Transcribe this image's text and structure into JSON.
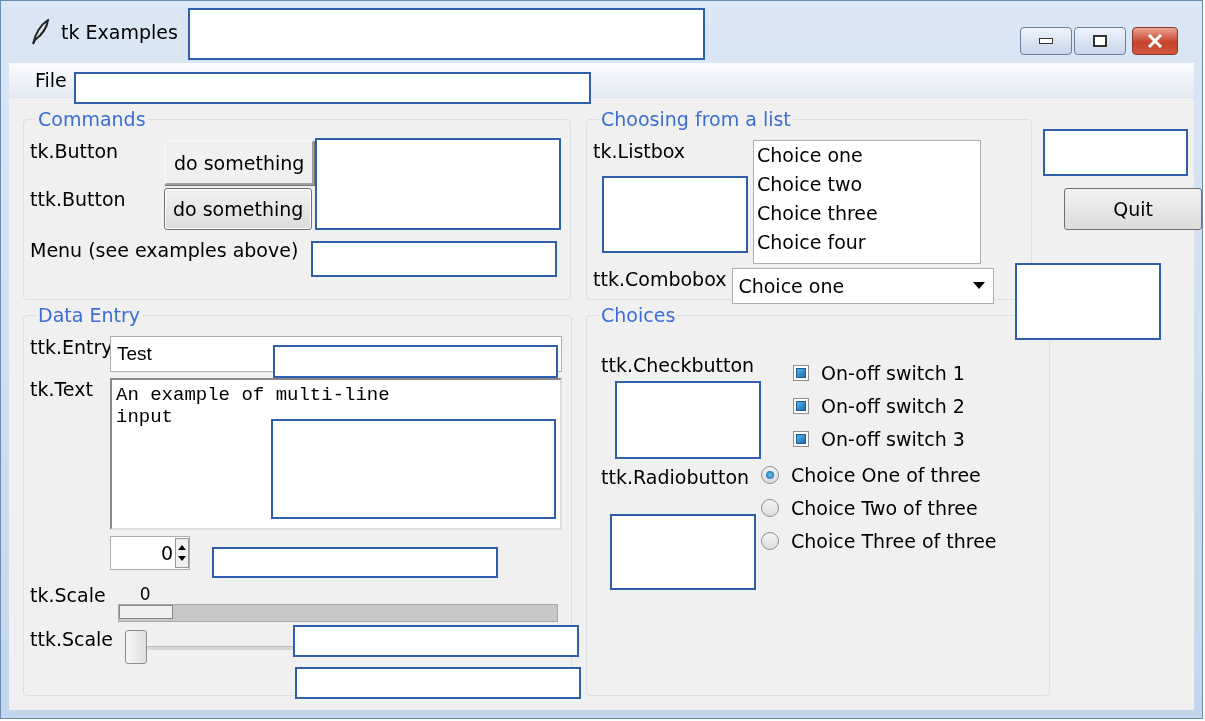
{
  "window": {
    "title": "tk Examples"
  },
  "menu": [
    "File"
  ],
  "commands": {
    "title": "Commands",
    "rows": [
      {
        "kind": "tk_button",
        "label": "tk.Button",
        "button": "do something"
      },
      {
        "kind": "ttk_button",
        "label": "ttk.Button",
        "button": "do something"
      },
      {
        "kind": "text",
        "label": "Menu (see examples above)"
      }
    ]
  },
  "data_entry": {
    "title": "Data Entry",
    "entry": {
      "label": "ttk.Entry",
      "value": "Test"
    },
    "text": {
      "label": "tk.Text",
      "value": "An example of multi-line\ninput"
    },
    "spinbox": {
      "value": "0"
    },
    "tk_scale": {
      "label": "tk.Scale",
      "reading": "0",
      "level": 0
    },
    "ttk_scale": {
      "label": "ttk.Scale",
      "level": 0
    }
  },
  "list_choice": {
    "title": "Choosing from a list",
    "listbox": {
      "label": "tk.Listbox",
      "items": [
        "Choice one",
        "Choice two",
        "Choice three",
        "Choice four"
      ]
    },
    "combobox": {
      "label": "ttk.Combobox",
      "value": "Choice one"
    }
  },
  "choices": {
    "title": "Choices",
    "checkbuttons": {
      "label": "ttk.Checkbutton",
      "items": [
        {
          "label": "On-off switch 1",
          "checked": true
        },
        {
          "label": "On-off switch 2",
          "checked": true
        },
        {
          "label": "On-off switch 3",
          "checked": true
        }
      ]
    },
    "radiobuttons": {
      "label": "ttk.Radiobutton",
      "items": [
        {
          "label": "Choice One of three",
          "selected": true
        },
        {
          "label": "Choice Two of three",
          "selected": false
        },
        {
          "label": "Choice Three of three",
          "selected": false
        }
      ]
    }
  },
  "quit_button": "Quit",
  "redaction_boxes": [
    {
      "kind": "blank"
    },
    {
      "kind": "blank"
    },
    {
      "kind": "blank"
    },
    {
      "kind": "blank"
    },
    {
      "kind": "blank"
    },
    {
      "kind": "blank"
    },
    {
      "kind": "blank"
    },
    {
      "kind": "blank"
    },
    {
      "kind": "blank"
    },
    {
      "kind": "blank"
    },
    {
      "kind": "blank"
    },
    {
      "kind": "blank"
    },
    {
      "kind": "blank"
    },
    {
      "kind": "blank"
    }
  ]
}
